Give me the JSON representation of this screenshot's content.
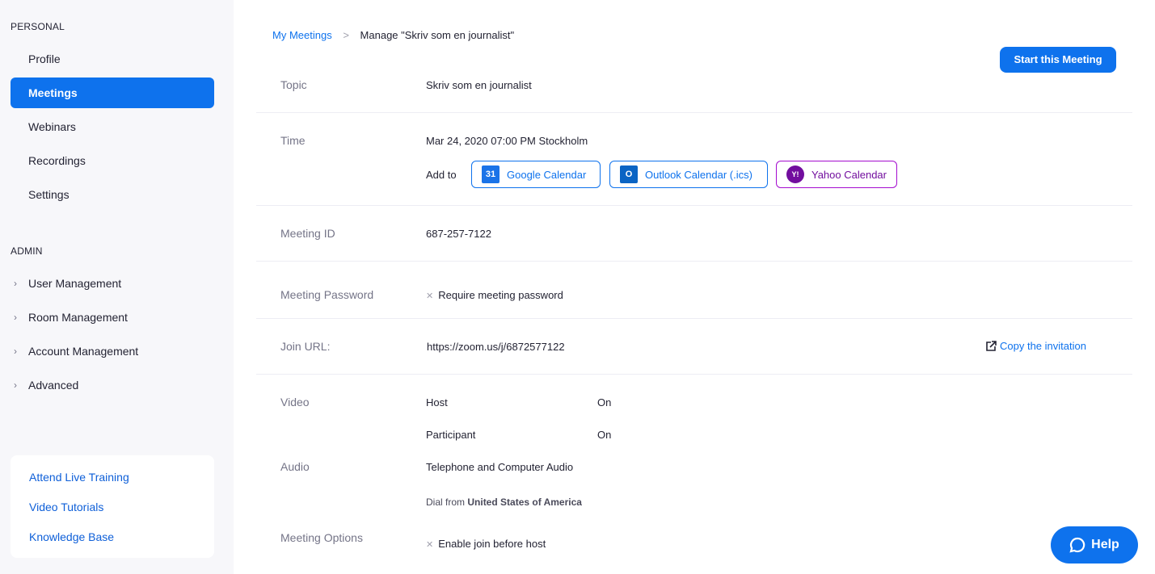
{
  "sidebar": {
    "personal_title": "PERSONAL",
    "personal_items": [
      {
        "label": "Profile"
      },
      {
        "label": "Meetings"
      },
      {
        "label": "Webinars"
      },
      {
        "label": "Recordings"
      },
      {
        "label": "Settings"
      }
    ],
    "admin_title": "ADMIN",
    "admin_items": [
      {
        "label": "User Management"
      },
      {
        "label": "Room Management"
      },
      {
        "label": "Account Management"
      },
      {
        "label": "Advanced"
      }
    ],
    "help_links": [
      {
        "label": "Attend Live Training"
      },
      {
        "label": "Video Tutorials"
      },
      {
        "label": "Knowledge Base"
      }
    ]
  },
  "breadcrumb": {
    "parent": "My Meetings",
    "separator": ">",
    "current": "Manage \"Skriv som en journalist\""
  },
  "start_button": "Start this Meeting",
  "topic": {
    "label": "Topic",
    "value": "Skriv som en journalist"
  },
  "time": {
    "label": "Time",
    "value": "Mar 24, 2020 07:00 PM Stockholm",
    "add_to": "Add to",
    "calendars": [
      {
        "label": "Google Calendar",
        "icon": "31"
      },
      {
        "label": "Outlook Calendar (.ics)",
        "icon": "O"
      },
      {
        "label": "Yahoo Calendar",
        "icon": "Y!"
      }
    ]
  },
  "meeting_id": {
    "label": "Meeting ID",
    "value": "687-257-7122"
  },
  "password": {
    "label": "Meeting Password",
    "value": "Require meeting password"
  },
  "join_url": {
    "label": "Join URL:",
    "value": "https://zoom.us/j/6872577122",
    "copy": "Copy the invitation"
  },
  "video": {
    "label": "Video",
    "host_label": "Host",
    "host_value": "On",
    "participant_label": "Participant",
    "participant_value": "On"
  },
  "audio": {
    "label": "Audio",
    "value": "Telephone and Computer Audio",
    "dial_prefix": "Dial from",
    "dial_country": "United States of America"
  },
  "options": {
    "label": "Meeting Options",
    "value": "Enable join before host"
  },
  "help_button": "Help",
  "colors": {
    "accent": "#0e72ed",
    "yahoo": "#720e9e"
  }
}
